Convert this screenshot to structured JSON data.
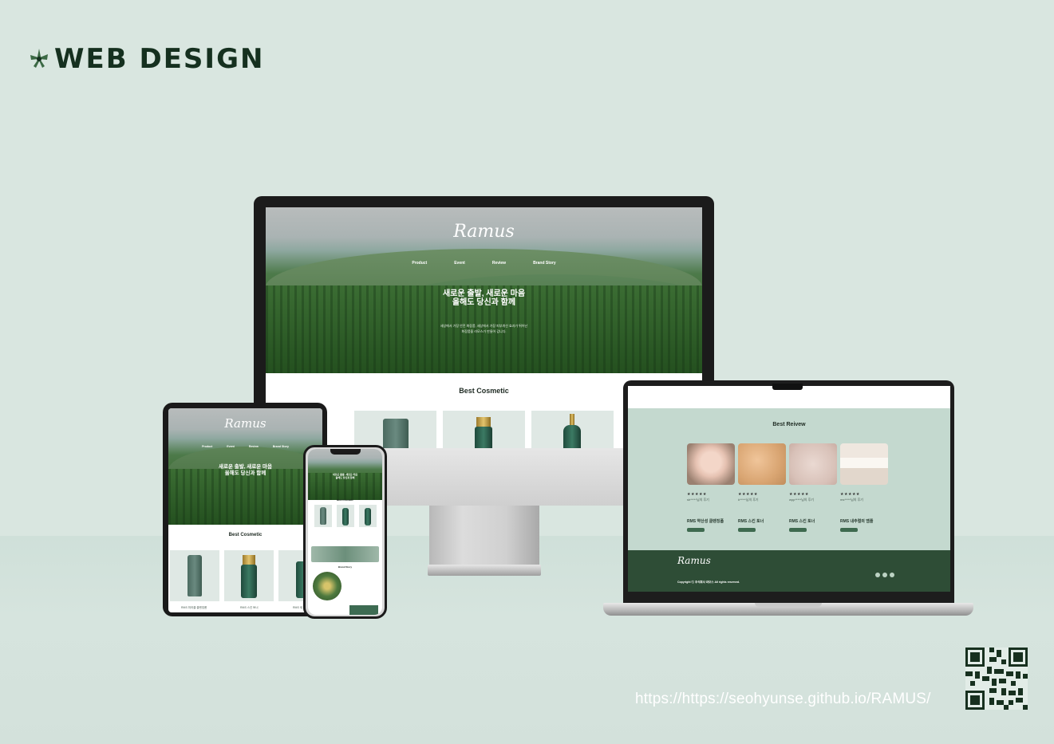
{
  "heading": "WEB DESIGN",
  "url": "https://https://seohyunse.github.io/RAMUS/",
  "site": {
    "logo": "Ramus",
    "nav": [
      "Product",
      "Event",
      "Review",
      "Brand Story"
    ],
    "hero_title_line1": "새로운 출발, 새로운 마음",
    "hero_title_line2": "올해도 당신과 함께",
    "hero_sub_line1": "세상에서 가장 안전 화장품, 세상에서 가장 피부개선 효과가 뛰어난",
    "hero_sub_line2": "화장품을 라모스가 만들어 갑니다.",
    "best_cosmetic": "Best Cosmetic",
    "best_review": "Best Reivew",
    "brand_story": "Brand Story",
    "tablet_products": [
      "RMS 미라클 클렌징폼",
      "RMS 스킨 토너",
      "RMS 세"
    ],
    "reviews": [
      {
        "stars": "★★★★★",
        "user": "sh*****님의 후기",
        "product": "RMS 약산성 클렌징폼"
      },
      {
        "stars": "★★★★★",
        "user": "k*****님의 후기",
        "product": "RMS 스킨 토너"
      },
      {
        "stars": "★★★★★",
        "user": "wpp*****님의 후기",
        "product": "RMS 스킨 토너"
      },
      {
        "stars": "★★★★★",
        "user": "ms*****님의 후기",
        "product": "RMS 내추럴의 앰플"
      }
    ],
    "footer_copy": "Copyright ⓒ 주식회사 라모스 All rights reserved."
  },
  "colors": {
    "background": "#d9e6e0",
    "brand_dark": "#15301f",
    "footer": "#2e4d36",
    "review_bg": "#c4d9cf"
  }
}
